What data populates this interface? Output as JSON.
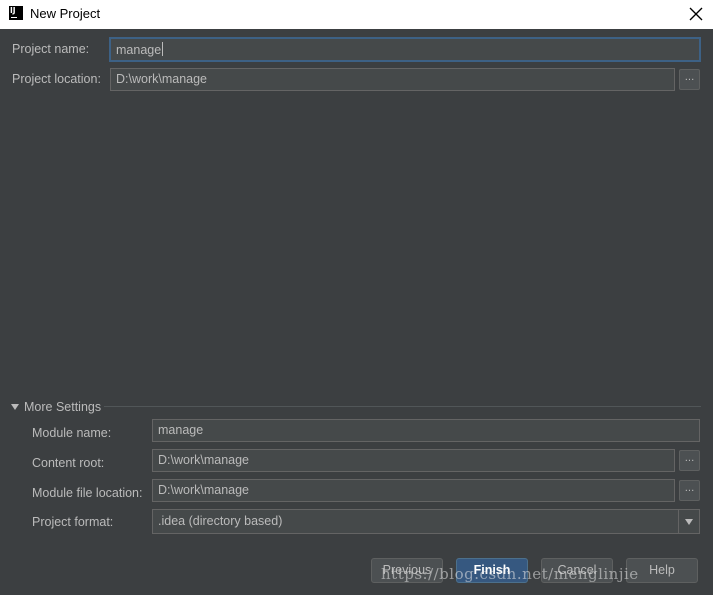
{
  "window": {
    "logo_text": "IJ",
    "title": "New Project"
  },
  "form": {
    "project_name_label": "Project name:",
    "project_name_value": "manage",
    "project_location_label": "Project location:",
    "project_location_value": "D:\\work\\manage",
    "browse_label": "..."
  },
  "more_settings": {
    "toggle_label": "More Settings",
    "expanded": true,
    "module_name_label": "Module name:",
    "module_name_value": "manage",
    "content_root_label": "Content root:",
    "content_root_value": "D:\\work\\manage",
    "module_file_location_label": "Module file location:",
    "module_file_location_value": "D:\\work\\manage",
    "project_format_label": "Project format:",
    "project_format_value": ".idea (directory based)"
  },
  "buttons": {
    "previous": "Previous",
    "finish": "Finish",
    "cancel": "Cancel",
    "help": "Help"
  },
  "watermark": "https://blog.csdn.net/menglinjie",
  "colors": {
    "background": "#3c3f41",
    "field": "#45494a",
    "primary_button": "#365880",
    "focus_border": "#3d6185"
  }
}
